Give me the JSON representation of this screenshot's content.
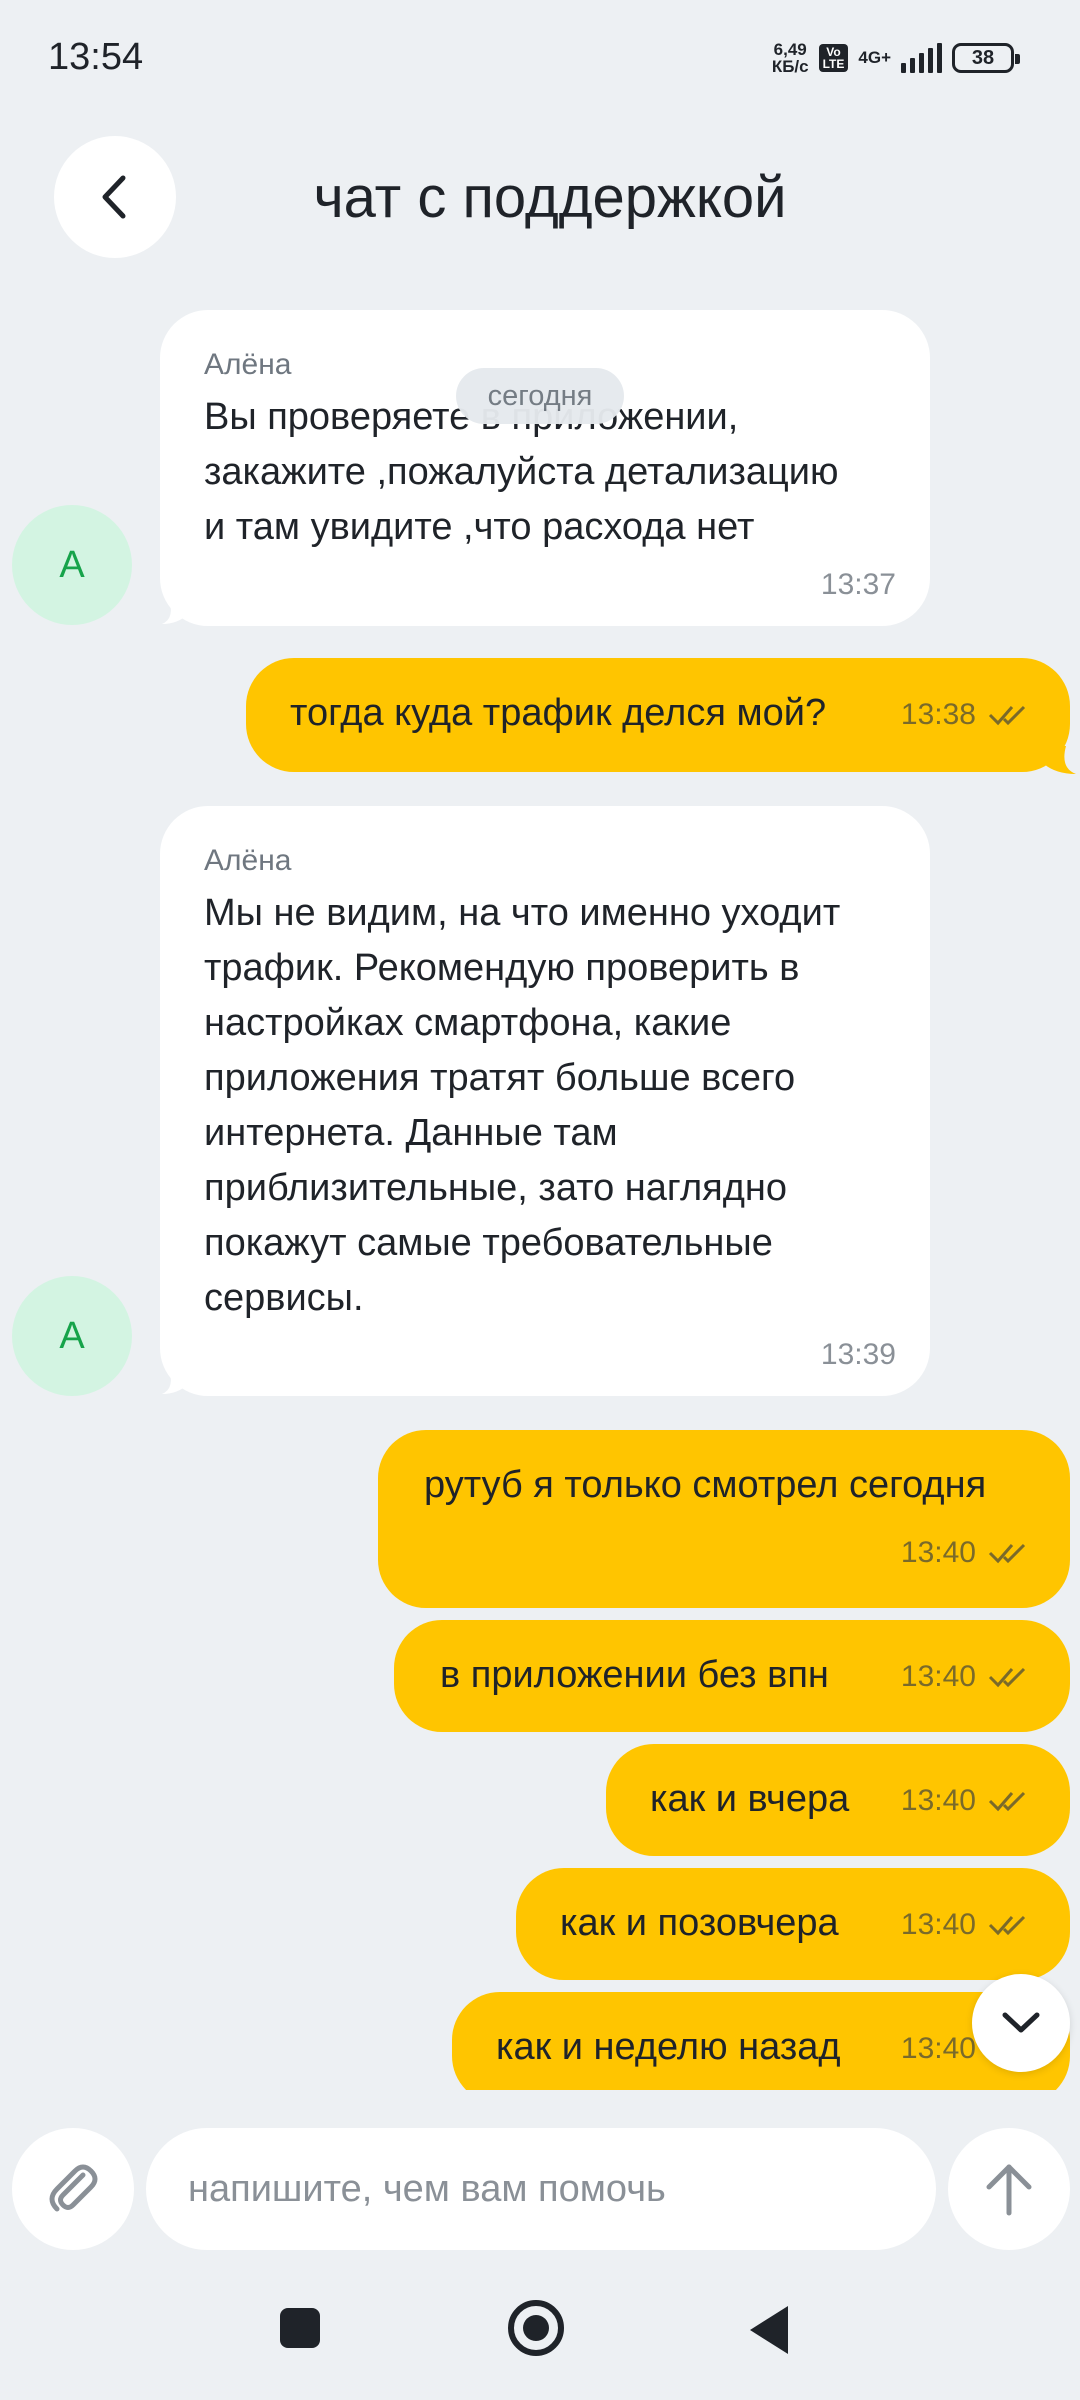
{
  "status_bar": {
    "time": "13:54",
    "speed_value": "6,49",
    "speed_unit": "КБ/с",
    "volte_top": "Vo",
    "volte_bottom": "LTE",
    "network": "4G+",
    "battery": "38"
  },
  "header": {
    "title": "чат с поддержкой",
    "back_icon": "chevron-left-icon"
  },
  "date_chip": "сегодня",
  "messages": [
    {
      "direction": "incoming",
      "sender": "Алёна",
      "text_lines": [
        "Вы проверяете в приложении,",
        "закажите ,пожалуйста детализацию",
        "и там увидите ,что расхода нет"
      ],
      "time": "13:37",
      "avatar": "А"
    },
    {
      "direction": "outgoing",
      "text": "тогда куда трафик делся мой?",
      "time": "13:38"
    },
    {
      "direction": "incoming",
      "sender": "Алёна",
      "text_lines": [
        "Мы не видим, на что именно уходит",
        "трафик. Рекомендую проверить в",
        "настройках смартфона, какие",
        "приложения тратят больше всего",
        "интернета. Данные там",
        "приблизительные, зато наглядно",
        "покажут самые требовательные",
        "сервисы."
      ],
      "time": "13:39",
      "avatar": "А"
    },
    {
      "direction": "outgoing",
      "text": "рутуб я только смотрел сегодня",
      "time": "13:40"
    },
    {
      "direction": "outgoing",
      "text": "в приложении без впн",
      "time": "13:40"
    },
    {
      "direction": "outgoing",
      "text": "как и вчера",
      "time": "13:40"
    },
    {
      "direction": "outgoing",
      "text": "как и позовчера",
      "time": "13:40"
    },
    {
      "direction": "outgoing",
      "text": "как и неделю назад",
      "time": "13:40"
    }
  ],
  "input": {
    "placeholder": "напишите, чем вам помочь",
    "attach_icon": "paperclip-icon",
    "send_icon": "arrow-up-icon"
  },
  "scroll_down_icon": "chevron-down-icon",
  "colors": {
    "background": "#edf0f3",
    "outgoing_bubble": "#ffc500",
    "incoming_bubble": "#ffffff",
    "avatar_bg": "#d3f4e2",
    "avatar_text": "#16a34a"
  }
}
